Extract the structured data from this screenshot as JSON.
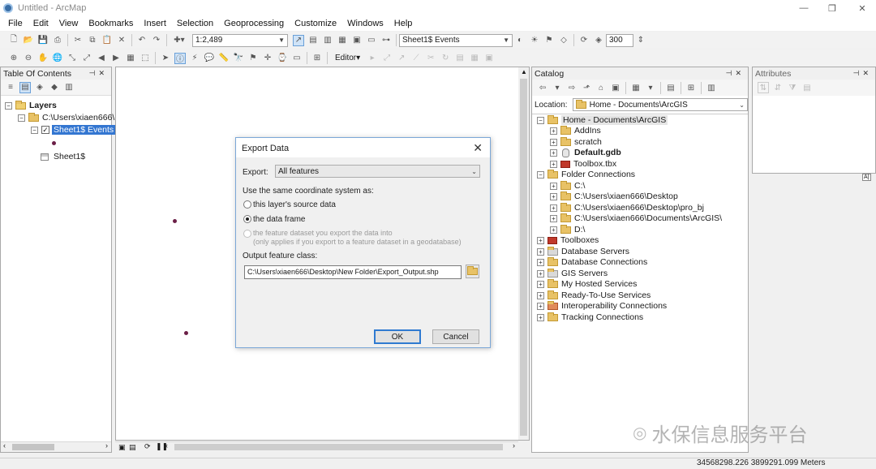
{
  "window": {
    "title": "Untitled - ArcMap",
    "minimize": "—",
    "maximize": "❐",
    "close": "✕"
  },
  "menu": [
    "File",
    "Edit",
    "View",
    "Bookmarks",
    "Insert",
    "Selection",
    "Geoprocessing",
    "Customize",
    "Windows",
    "Help"
  ],
  "toolbar": {
    "scale": "1:2,489",
    "layer": "Sheet1$ Events",
    "zoom_value": "300",
    "editor": "Editor▾"
  },
  "toc": {
    "title": "Table Of Contents",
    "layers_label": "Layers",
    "path_label": "C:\\Users\\xiaen666\\",
    "events_layer": "Sheet1$ Events",
    "table_label": "Sheet1$"
  },
  "dialog": {
    "title": "Export Data",
    "export_label": "Export:",
    "export_value": "All features",
    "coord_heading": "Use the same coordinate system as:",
    "opt_source": "this layer's source data",
    "opt_frame": "the data frame",
    "opt_feature_1": "the feature dataset you export the data into",
    "opt_feature_2": "(only applies if you export to a feature dataset in a geodatabase)",
    "output_label": "Output feature class:",
    "output_path": "C:\\Users\\xiaen666\\Desktop\\New Folder\\Export_Output.shp",
    "ok": "OK",
    "cancel": "Cancel"
  },
  "catalog": {
    "title": "Catalog",
    "location_label": "Location:",
    "location_value": "Home - Documents\\ArcGIS",
    "items": [
      "Home - Documents\\ArcGIS",
      "AddIns",
      "scratch",
      "Default.gdb",
      "Toolbox.tbx",
      "Folder Connections",
      "C:\\",
      "C:\\Users\\xiaen666\\Desktop",
      "C:\\Users\\xiaen666\\Desktop\\pro_bj",
      "C:\\Users\\xiaen666\\Documents\\ArcGIS\\",
      "D:\\",
      "Toolboxes",
      "Database Servers",
      "Database Connections",
      "GIS Servers",
      "My Hosted Services",
      "Ready-To-Use Services",
      "Interoperability Connections",
      "Tracking Connections"
    ]
  },
  "attributes": {
    "title": "Attributes"
  },
  "status": {
    "coords": "34568298.226  3899291.099 Meters"
  },
  "watermark": "水保信息服务平台"
}
